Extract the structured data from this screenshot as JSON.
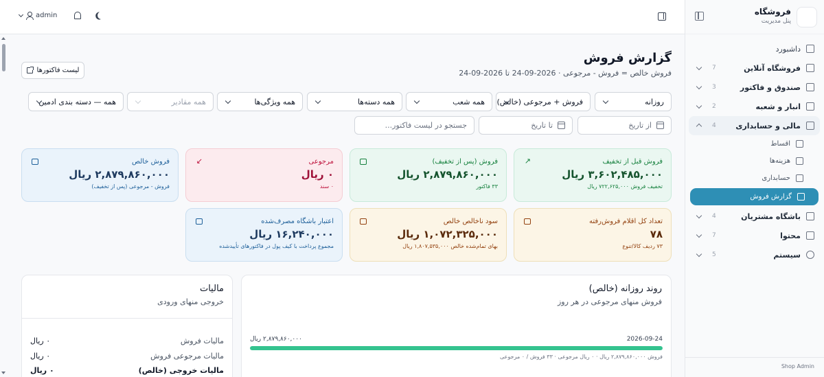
{
  "brand": {
    "title": "فروشگاه",
    "subtitle": "پنل مدیریت"
  },
  "topbar": {
    "user": "admin"
  },
  "sidebar": {
    "items": [
      {
        "label": "داشبورد",
        "count": ""
      },
      {
        "label": "فروشگاه آنلاین",
        "count": "7"
      },
      {
        "label": "صندوق و فاکتور",
        "count": "3"
      },
      {
        "label": "انبار و شعبه",
        "count": "2"
      },
      {
        "label": "مالی و حسابداری",
        "count": "4"
      },
      {
        "label": "باشگاه مشتریان",
        "count": "4"
      },
      {
        "label": "محتوا",
        "count": "7"
      },
      {
        "label": "سیستم",
        "count": "5"
      }
    ],
    "subitems": [
      "اقساط",
      "هزینه‌ها",
      "حسابداری",
      "گزارش فروش"
    ],
    "footer": "Shop Admin"
  },
  "page": {
    "title": "گزارش فروش",
    "subtitle": "فروش خالص = فروش - مرجوعی · 2026-09-24 تا 2026-09-24",
    "invoice_list_label": "لیست فاکتورها"
  },
  "filters": {
    "period": "روزانه",
    "mode": "فروش + مرجوعی (خالص)",
    "branch": "همه شعب",
    "category": "همه دسته‌ها",
    "attribute": "همه ویژگی‌ها",
    "values": "همه مقادیر",
    "grouping": "همه — دسته بندی ادمین",
    "date_from": "از تاریخ",
    "date_to": "تا تاریخ",
    "search_placeholder": "جستجو در لیست فاکتور..."
  },
  "cards": {
    "gross": {
      "label": "فروش قبل از تخفیف",
      "value": "۳,۶۰۲,۴۸۵,۰۰۰ ریال",
      "note": "تخفیف فروش ۷۲۲,۶۲۵,۰۰۰ ریال"
    },
    "after_discount": {
      "label": "فروش (پس از تخفیف)",
      "value": "۲,۸۷۹,۸۶۰,۰۰۰ ریال",
      "note": "۳۳ فاکتور"
    },
    "returns": {
      "label": "مرجوعی",
      "value": "۰ ریال",
      "note": "۰ سند"
    },
    "net": {
      "label": "فروش خالص",
      "value": "۲,۸۷۹,۸۶۰,۰۰۰ ریال",
      "note": "فروش - مرجوعی (پس از تخفیف)"
    },
    "items_sold": {
      "label": "تعداد کل اقلام فروش‌رفته",
      "value": "۷۸",
      "note": "۷۳ ردیف کالا/تنوع"
    },
    "gross_profit": {
      "label": "سود ناخالص خالص",
      "value": "۱,۰۷۲,۳۲۵,۰۰۰ ریال",
      "note": "بهای تمام‌شده خالص ۱,۸۰۷,۵۳۵,۰۰۰ ریال"
    },
    "wallet_credit": {
      "label": "اعتبار باشگاه مصرف‌شده",
      "value": "۱۶,۲۴۰,۰۰۰ ریال",
      "note": "مجموع پرداخت با کیف پول در فاکتورهای تأییدشده"
    }
  },
  "trend": {
    "title": "روند روزانه (خالص)",
    "subtitle": "فروش منهای مرجوعی در هر روز",
    "date": "2026-09-24",
    "amount": "۲,۸۷۹,۸۶۰,۰۰۰ ریال",
    "fill_percent": 100,
    "detail": "فروش ۲,۸۷۹,۸۶۰,۰۰۰ ریال · ۰ ریال مرجوعی · ۳۳ فروش / ۰ مرجوعی"
  },
  "tax": {
    "title": "مالیات",
    "subtitle": "خروجی منهای ورودی",
    "rows": [
      {
        "label": "مالیات فروش",
        "value": "۰ ریال"
      },
      {
        "label": "مالیات مرجوعی فروش",
        "value": "۰ ریال"
      },
      {
        "label": "مالیات خروجی (خالص)",
        "value": "۰ ریال"
      }
    ]
  },
  "colors": {
    "accent": "#2e8fb5",
    "bar": "#34c38f"
  }
}
